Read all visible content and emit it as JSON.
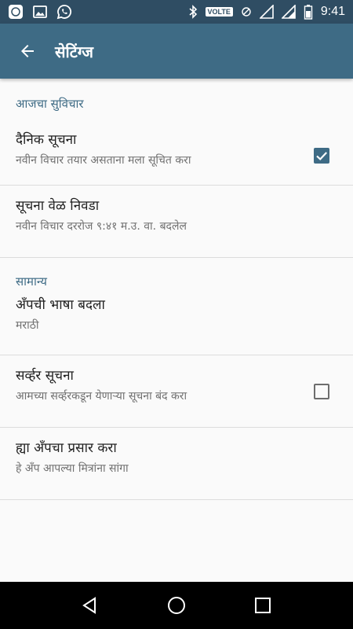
{
  "status_bar": {
    "time": "9:41",
    "volte": "VOLTE",
    "network": "LTE"
  },
  "app_bar": {
    "title": "सेटिंग्ज"
  },
  "sections": [
    {
      "header": "आजचा सुविचार",
      "items": [
        {
          "title": "दैनिक सूचना",
          "subtitle": "नवीन विचार तयार असताना मला सूचित करा",
          "checked": true
        },
        {
          "title": "सूचना वेळ निवडा",
          "subtitle": "नवीन विचार दररोज ९:४१ म.उ. वा. बदलेल"
        }
      ]
    },
    {
      "header": "सामान्य",
      "items": [
        {
          "title": "अँपची भाषा बदला",
          "subtitle": "मराठी"
        },
        {
          "title": "सर्व्हर सूचना",
          "subtitle": "आमच्या सर्व्हरकडून येणाऱ्या सूचना बंद करा",
          "checked": false
        },
        {
          "title": "ह्या अँपचा प्रसार करा",
          "subtitle": "हे अँप आपल्या मित्रांना सांगा"
        }
      ]
    }
  ],
  "colors": {
    "status_bar": "#2f4d63",
    "app_bar": "#3e6b85",
    "accent": "#3e6b85"
  }
}
